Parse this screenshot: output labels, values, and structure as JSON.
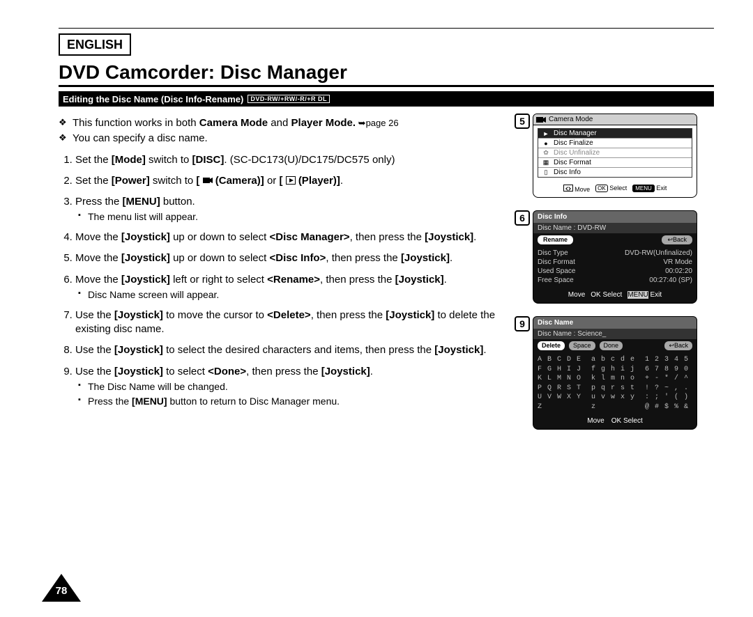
{
  "header": {
    "language": "ENGLISH",
    "title": "DVD Camcorder: Disc Manager",
    "section_title": "Editing the Disc Name (Disc Info-Rename)",
    "media_badge": "DVD-RW/+RW/-R/+R DL"
  },
  "bullets": [
    {
      "pre": "This function works in both ",
      "b1": "Camera Mode",
      "mid": " and ",
      "b2": "Player Mode.",
      "post": " ➥page 26"
    },
    {
      "pre": "You can specify a disc name.",
      "b1": "",
      "mid": "",
      "b2": "",
      "post": ""
    }
  ],
  "steps": {
    "s1": {
      "a": "Set the ",
      "b1": "[Mode]",
      "b": " switch to ",
      "b2": "[DISC]",
      "c": ". (SC-DC173(U)/DC175/DC575 only)"
    },
    "s2": {
      "a": "Set the ",
      "b1": "[Power]",
      "b": " switch to ",
      "b2": "[",
      "cam": "(Camera)]",
      "c": " or ",
      "b3": "[",
      "play": "(Player)]",
      "d": "."
    },
    "s3": {
      "a": "Press the ",
      "b1": "[MENU]",
      "b": " button.",
      "sub1": "The menu list will appear."
    },
    "s4": {
      "a": "Move the ",
      "b1": "[Joystick]",
      "b": " up or down to select ",
      "b2": "<Disc Manager>",
      "c": ", then press the ",
      "b3": "[Joystick]",
      "d": "."
    },
    "s5": {
      "a": "Move the ",
      "b1": "[Joystick]",
      "b": " up or down to select ",
      "b2": "<Disc Info>",
      "c": ", then press the ",
      "b3": "[Joystick]",
      "d": "."
    },
    "s6": {
      "a": "Move the ",
      "b1": "[Joystick]",
      "b": " left or right to select ",
      "b2": "<Rename>",
      "c": ", then press the ",
      "b3": "[Joystick]",
      "d": ".",
      "sub1": "Disc Name screen will appear."
    },
    "s7": {
      "a": "Use the ",
      "b1": "[Joystick]",
      "b": " to move the cursor to ",
      "b2": "<Delete>",
      "c": ", then press the ",
      "b3": "[Joystick]",
      "d": " to delete the existing disc name."
    },
    "s8": {
      "a": "Use the ",
      "b1": "[Joystick]",
      "b": " to select the desired characters and items, then press the ",
      "b2": "[Joystick]",
      "c": "."
    },
    "s9": {
      "a": "Use the ",
      "b1": "[Joystick]",
      "b": " to select ",
      "b2": "<Done>",
      "c": ", then press the ",
      "b3": "[Joystick]",
      "d": ".",
      "sub1": "The Disc Name will be changed.",
      "sub2a": "Press the ",
      "sub2b": "[MENU]",
      "sub2c": " button to return to Disc Manager menu."
    }
  },
  "figures": {
    "f5": {
      "num": "5",
      "mode_title": "Camera Mode",
      "items": [
        {
          "icon": "►",
          "label": "Disc Manager",
          "selected": true
        },
        {
          "icon": "●",
          "label": "Disc Finalize"
        },
        {
          "icon": "✿",
          "label": "Disc Unfinalize",
          "disabled": true
        },
        {
          "icon": "▦",
          "label": "Disc Format"
        },
        {
          "icon": "▯",
          "label": "Disc Info"
        }
      ],
      "nav": {
        "move": "Move",
        "select": "Select",
        "exit": "Exit",
        "ok": "OK",
        "menu": "MENU"
      }
    },
    "f6": {
      "num": "6",
      "title": "Disc Info",
      "name_label": "Disc Name : DVD-RW",
      "buttons": {
        "rename": "Rename",
        "back": "↩Back"
      },
      "rows": [
        {
          "k": "Disc Type",
          "v": "DVD-RW(Unfinalized)"
        },
        {
          "k": "Disc Format",
          "v": "VR Mode"
        },
        {
          "k": "Used Space",
          "v": "00:02:20"
        },
        {
          "k": "Free Space",
          "v": "00:27:40 (SP)"
        }
      ],
      "nav": {
        "move": "Move",
        "select": "Select",
        "exit": "Exit",
        "ok": "OK",
        "menu": "MENU"
      }
    },
    "f9": {
      "num": "9",
      "title": "Disc Name",
      "name_label": "Disc Name : Science_",
      "buttons": {
        "delete": "Delete",
        "space": "Space",
        "done": "Done",
        "back": "↩Back"
      },
      "kb_lines": [
        "A B C D E  a b c d e  1 2 3 4 5",
        "F G H I J  f g h i j  6 7 8 9 0",
        "K L M N O  k l m n o  + - * / ^",
        "P Q R S T  p q r s t  ! ? ~ , .",
        "U V W X Y  u v w x y  : ; ' ( )",
        "Z          z          @ # $ % &"
      ],
      "nav": {
        "move": "Move",
        "select": "Select",
        "ok": "OK"
      }
    }
  },
  "page_number": "78"
}
